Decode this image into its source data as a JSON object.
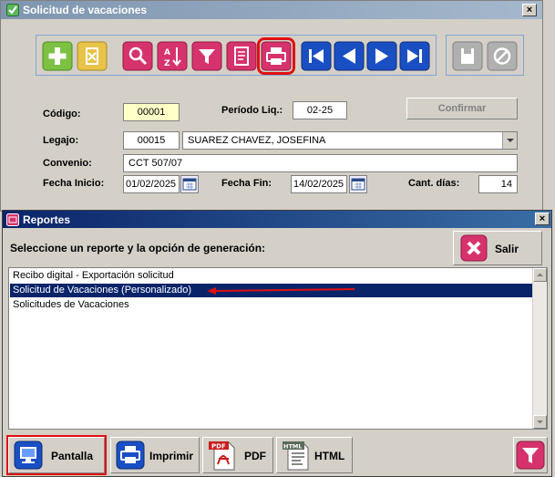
{
  "solicitud_window": {
    "title": "Solicitud de vacaciones",
    "close_label": "×",
    "toolbar": {
      "buttons": [
        "add-icon",
        "delete-icon",
        "search-icon",
        "sort-icon",
        "filter-icon",
        "report-icon",
        "print-icon",
        "first-icon",
        "prev-icon",
        "next-icon",
        "last-icon"
      ],
      "extra_buttons": [
        "save-icon",
        "cancel-icon"
      ]
    },
    "codigo_label": "Código:",
    "codigo_value": "00001",
    "periodo_label": "Período Liq.:",
    "periodo_value": "02-25",
    "confirm_label": "Confirmar",
    "legajo_label": "Legajo:",
    "legajo_value": "00015",
    "legajo_name": "SUAREZ CHAVEZ, JOSEFINA",
    "convenio_label": "Convenio:",
    "convenio_value": "CCT 507/07",
    "fecha_inicio_label": "Fecha Inicio:",
    "fecha_inicio_value": "01/02/2025",
    "fecha_fin_label": "Fecha Fin:",
    "fecha_fin_value": "14/02/2025",
    "cant_dias_label": "Cant. días:",
    "cant_dias_value": "14"
  },
  "reportes_window": {
    "title": "Reportes",
    "close_label": "×",
    "prompt": "Seleccione un reporte y la opción de generación:",
    "salir_label": "Salir",
    "items": [
      "Recibo digital - Exportación solicitud",
      "Solicitud de Vacaciones (Personalizado)",
      "Solicitudes de Vacaciones"
    ],
    "selected_index": 1,
    "buttons": {
      "pantalla": "Pantalla",
      "imprimir": "Imprimir",
      "pdf": "PDF",
      "html": "HTML"
    },
    "pdf_icon_text": "PDF",
    "html_icon_text": "HTML"
  },
  "colors": {
    "highlight_red": "#e01010",
    "selection_blue": "#0a246a",
    "toolbar_magenta": "#d6336c",
    "toolbar_blue": "#1a4fc4"
  }
}
